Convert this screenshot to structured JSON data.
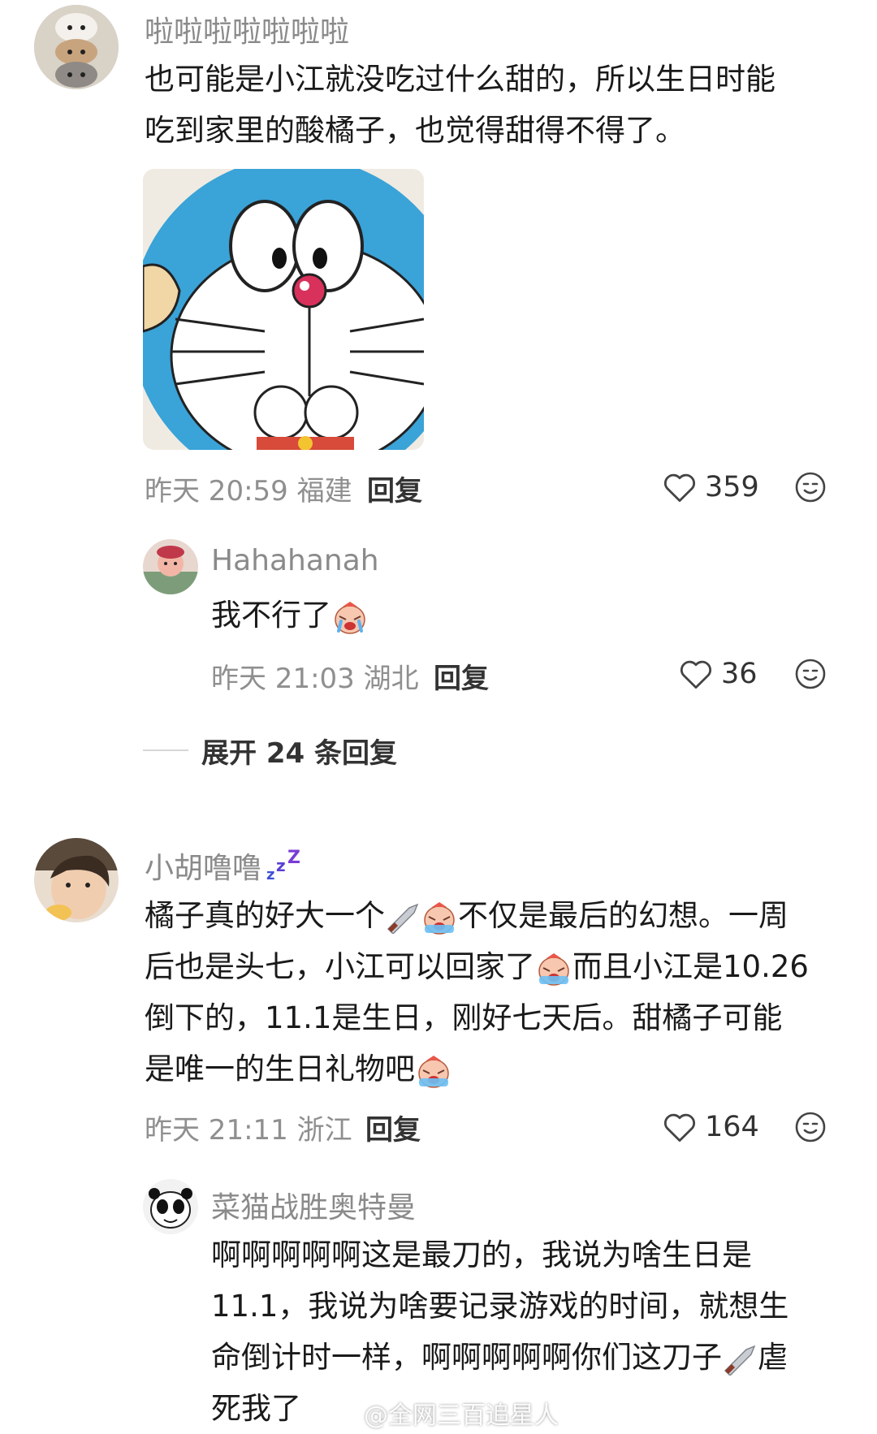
{
  "comments": [
    {
      "username": "啦啦啦啦啦啦啦",
      "text_lines": [
        "也可能是小江就没吃过什么甜的，所以生日时能",
        "吃到家里的酸橘子，也觉得甜得不得了。"
      ],
      "time": "昨天 20:59 福建",
      "reply_label": "回复",
      "likes": "359"
    },
    {
      "username": "Hahahanah",
      "text": "我不行了",
      "time": "昨天 21:03 湖北",
      "reply_label": "回复",
      "likes": "36"
    },
    {
      "expand_label": "展开 24 条回复"
    },
    {
      "username": "小胡噜噜",
      "text_l1a": "橘子真的好大一个",
      "text_l1b": "不仅是最后的幻想。一周",
      "text_l2a": "后也是头七，小江可以回家了",
      "text_l2b": "而且小江是10.26",
      "text_l3": "倒下的，11.1是生日，刚好七天后。甜橘子可能",
      "text_l4": "是唯一的生日礼物吧",
      "time": "昨天 21:11 浙江",
      "reply_label": "回复",
      "likes": "164"
    },
    {
      "username": "菜猫战胜奥特曼",
      "text_l1": "啊啊啊啊啊这是最刀的，我说为啥生日是",
      "text_l2": "11.1，我说为啥要记录游戏的时间，就想生",
      "text_l3": "命倒计时一样，啊啊啊啊啊你们这刀子",
      "text_l3b": "虐",
      "text_l4": "死我了"
    }
  ],
  "watermark": "@全网三百追星人",
  "icons": {
    "like": "heart-outline-icon",
    "emoji_react": "smiley-icon",
    "crying": "crying-emoji",
    "knife": "knife-emoji",
    "sleepy": "zzz-icon"
  },
  "colors": {
    "username": "#8a8a8a",
    "meta": "#8f8f8f",
    "text": "#1a1a1a",
    "doraemon_blue": "#3aa3d8"
  }
}
